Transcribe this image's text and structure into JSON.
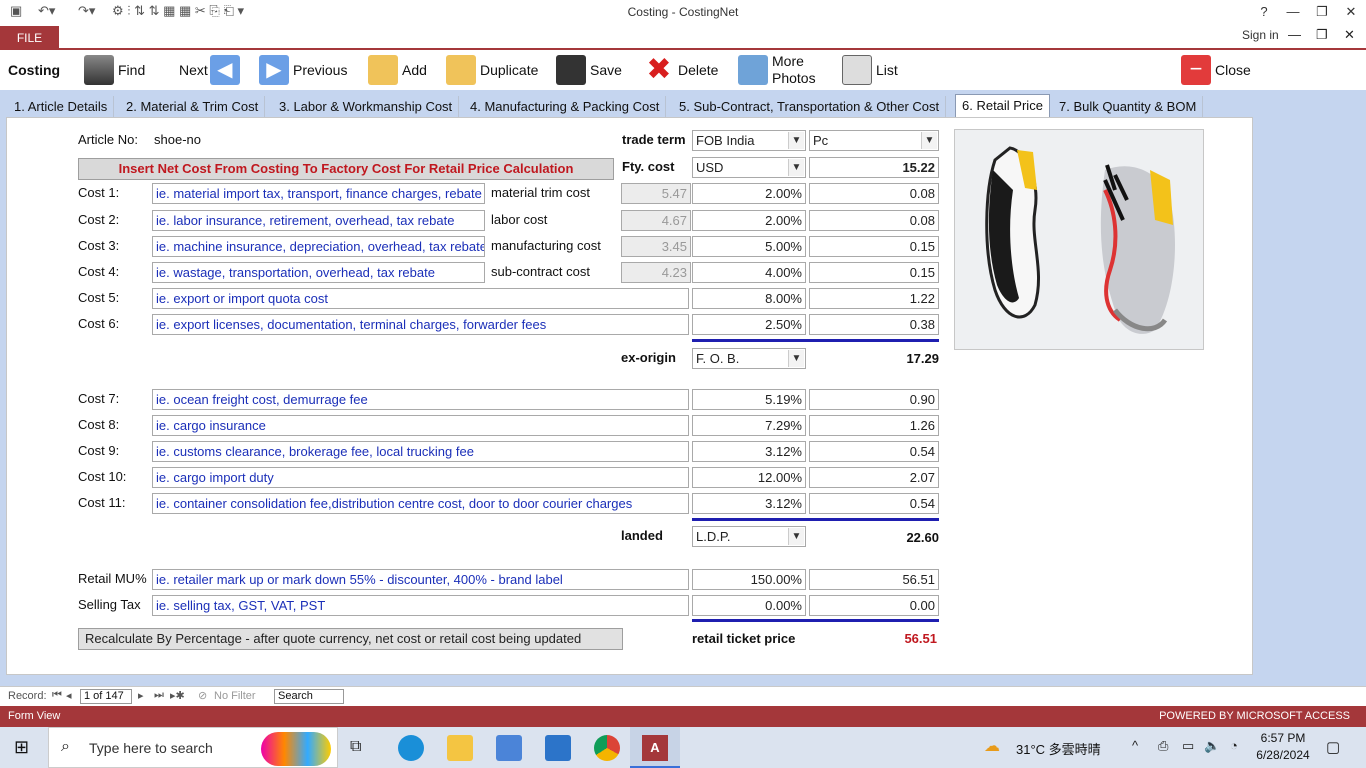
{
  "window": {
    "title": "Costing - CostingNet",
    "help": "?",
    "sign_in": "Sign in"
  },
  "file_tab": "FILE",
  "toolbar": {
    "section": "Costing",
    "find": "Find",
    "next": "Next",
    "previous": "Previous",
    "add": "Add",
    "duplicate": "Duplicate",
    "save": "Save",
    "delete": "Delete",
    "more_photos_1": "More",
    "more_photos_2": "Photos",
    "list": "List",
    "close": "Close"
  },
  "tabs": [
    "1. Article Details",
    "2. Material & Trim Cost",
    "3. Labor & Workmanship Cost",
    "4. Manufacturing & Packing Cost",
    "5. Sub-Contract, Transportation & Other Cost",
    "6. Retail Price",
    "7. Bulk Quantity & BOM"
  ],
  "form": {
    "article_no_label": "Article No:",
    "article_no": "shoe-no",
    "trade_term_label": "trade term",
    "trade_term": "FOB India",
    "unit": "Pc",
    "insert_button": "Insert Net Cost From Costing To Factory Cost For Retail Price Calculation",
    "fty_cost_label": "Fty. cost",
    "currency": "USD",
    "fty_cost": "15.22",
    "cost1_label": "Cost 1:",
    "cost1_desc": "ie. material import tax, transport, finance charges, rebate",
    "cost1_sub": "material trim cost",
    "cost1_base": "5.47",
    "cost1_pct": "2.00%",
    "cost1_val": "0.08",
    "cost2_label": "Cost 2:",
    "cost2_desc": "ie. labor insurance, retirement, overhead, tax rebate",
    "cost2_sub": "labor cost",
    "cost2_base": "4.67",
    "cost2_pct": "2.00%",
    "cost2_val": "0.08",
    "cost3_label": "Cost 3:",
    "cost3_desc": "ie. machine insurance, depreciation, overhead, tax rebate",
    "cost3_sub": "manufacturing cost",
    "cost3_base": "3.45",
    "cost3_pct": "5.00%",
    "cost3_val": "0.15",
    "cost4_label": "Cost 4:",
    "cost4_desc": "ie. wastage, transportation, overhead, tax rebate",
    "cost4_sub": "sub-contract cost",
    "cost4_base": "4.23",
    "cost4_pct": "4.00%",
    "cost4_val": "0.15",
    "cost5_label": "Cost 5:",
    "cost5_desc": "ie. export or import quota cost",
    "cost5_pct": "8.00%",
    "cost5_val": "1.22",
    "cost6_label": "Cost 6:",
    "cost6_desc": "ie. export licenses, documentation, terminal charges, forwarder fees",
    "cost6_pct": "2.50%",
    "cost6_val": "0.38",
    "ex_origin_label": "ex-origin",
    "ex_origin_term": "F. O. B.",
    "ex_origin_val": "17.29",
    "cost7_label": "Cost 7:",
    "cost7_desc": "ie. ocean freight cost, demurrage fee",
    "cost7_pct": "5.19%",
    "cost7_val": "0.90",
    "cost8_label": "Cost 8:",
    "cost8_desc": "ie. cargo insurance",
    "cost8_pct": "7.29%",
    "cost8_val": "1.26",
    "cost9_label": "Cost 9:",
    "cost9_desc": "ie. customs clearance, brokerage fee, local trucking fee",
    "cost9_pct": "3.12%",
    "cost9_val": "0.54",
    "cost10_label": "Cost 10:",
    "cost10_desc": "ie. cargo import duty",
    "cost10_pct": "12.00%",
    "cost10_val": "2.07",
    "cost11_label": "Cost 11:",
    "cost11_desc": "ie. container consolidation fee,distribution centre cost, door to door courier charges",
    "cost11_pct": "3.12%",
    "cost11_val": "0.54",
    "landed_label": "landed",
    "landed_term": "L.D.P.",
    "landed_val": "22.60",
    "retail_mu_label": "Retail MU%",
    "retail_mu_desc": "ie. retailer mark up or mark down  55% - discounter, 400% - brand label",
    "retail_mu_pct": "150.00%",
    "retail_mu_val": "56.51",
    "selling_tax_label": "Selling Tax",
    "selling_tax_desc": "ie. selling tax, GST, VAT, PST",
    "selling_tax_pct": "0.00%",
    "selling_tax_val": "0.00",
    "recalc_button": "Recalculate By Percentage - after quote currency, net cost or retail cost being updated",
    "retail_ticket_label": "retail ticket price",
    "retail_ticket_val": "56.51"
  },
  "record_nav": {
    "label": "Record:",
    "position": "1 of 147",
    "no_filter": "No Filter",
    "search": "Search"
  },
  "status": {
    "left": "Form View",
    "right": "POWERED BY MICROSOFT ACCESS"
  },
  "taskbar": {
    "search_placeholder": "Type here to search",
    "weather": "31°C  多雲時晴",
    "time": "6:57 PM",
    "date": "6/28/2024"
  },
  "colors": {
    "accent": "#a4373a",
    "tab_bg": "#c5d5ef",
    "link_blue": "#1b2fb8",
    "total_red": "#c0181f"
  }
}
